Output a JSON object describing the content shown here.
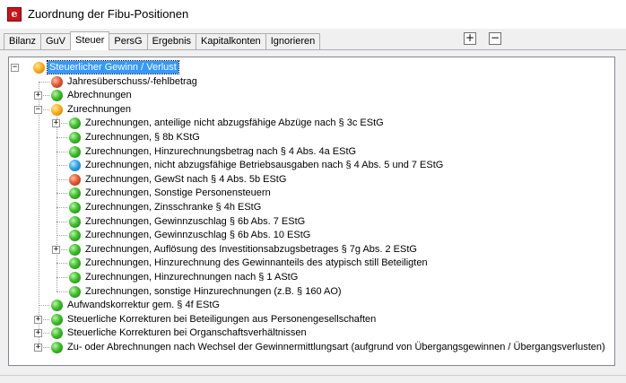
{
  "window": {
    "title": "Zuordnung der Fibu-Positionen",
    "icon": "app-icon"
  },
  "tabs": [
    {
      "label": "Bilanz",
      "active": false
    },
    {
      "label": "GuV",
      "active": false
    },
    {
      "label": "Steuer",
      "active": true
    },
    {
      "label": "PersG",
      "active": false
    },
    {
      "label": "Ergebnis",
      "active": false
    },
    {
      "label": "Kapitalkonten",
      "active": false
    },
    {
      "label": "Ignorieren",
      "active": false
    }
  ],
  "toolbar": {
    "expand_all": "+",
    "collapse_all": "−"
  },
  "colors": {
    "green": "#3fbf2a",
    "orange": "#ffae1a",
    "red": "#e85a32",
    "blue": "#2aa5ee",
    "selection": "#3399ff"
  },
  "tree": [
    {
      "label": "Steuerlicher Gewinn / Verlust",
      "level": 0,
      "status": "orange",
      "expander": "minus",
      "selected": true
    },
    {
      "label": "Jahresüberschuss/-fehlbetrag",
      "level": 1,
      "status": "red",
      "expander": null
    },
    {
      "label": "Abrechnungen",
      "level": 1,
      "status": "green",
      "expander": "plus"
    },
    {
      "label": "Zurechnungen",
      "level": 1,
      "status": "orange",
      "expander": "minus"
    },
    {
      "label": "Zurechnungen, anteilige nicht abzugsfähige Abzüge nach § 3c EStG",
      "level": 2,
      "status": "green",
      "expander": "plus"
    },
    {
      "label": "Zurechnungen, § 8b KStG",
      "level": 2,
      "status": "green",
      "expander": null
    },
    {
      "label": "Zurechnungen, Hinzurechnungsbetrag nach § 4 Abs. 4a EStG",
      "level": 2,
      "status": "green",
      "expander": null
    },
    {
      "label": "Zurechnungen, nicht abzugsfähige Betriebsausgaben nach § 4 Abs. 5 und 7 EStG",
      "level": 2,
      "status": "blue",
      "expander": null
    },
    {
      "label": "Zurechnungen, GewSt nach § 4 Abs. 5b EStG",
      "level": 2,
      "status": "red",
      "expander": null
    },
    {
      "label": "Zurechnungen, Sonstige Personensteuern",
      "level": 2,
      "status": "green",
      "expander": null
    },
    {
      "label": "Zurechnungen, Zinsschranke § 4h EStG",
      "level": 2,
      "status": "green",
      "expander": null
    },
    {
      "label": "Zurechnungen, Gewinnzuschlag § 6b Abs. 7 EStG",
      "level": 2,
      "status": "green",
      "expander": null
    },
    {
      "label": "Zurechnungen, Gewinnzuschlag § 6b Abs. 10 EStG",
      "level": 2,
      "status": "green",
      "expander": null
    },
    {
      "label": "Zurechnungen, Auflösung des Investitionsabzugsbetrages § 7g Abs. 2 EStG",
      "level": 2,
      "status": "green",
      "expander": "plus"
    },
    {
      "label": "Zurechnungen, Hinzurechnung des Gewinnanteils des atypisch still Beteiligten",
      "level": 2,
      "status": "green",
      "expander": null
    },
    {
      "label": "Zurechnungen, Hinzurechnungen nach § 1 AStG",
      "level": 2,
      "status": "green",
      "expander": null
    },
    {
      "label": "Zurechnungen, sonstige Hinzurechnungen (z.B. § 160 AO)",
      "level": 2,
      "status": "green",
      "expander": null
    },
    {
      "label": "Aufwandskorrektur gem. § 4f EStG",
      "level": 1,
      "status": "green",
      "expander": null
    },
    {
      "label": "Steuerliche Korrekturen bei Beteiligungen aus Personengesellschaften",
      "level": 1,
      "status": "green",
      "expander": "plus"
    },
    {
      "label": "Steuerliche Korrekturen bei Organschaftsverhältnissen",
      "level": 1,
      "status": "green",
      "expander": "plus"
    },
    {
      "label": "Zu- oder Abrechnungen nach Wechsel der Gewinnermittlungsart (aufgrund von Übergangsgewinnen / Übergangsverlusten)",
      "level": 1,
      "status": "green",
      "expander": "plus"
    }
  ]
}
